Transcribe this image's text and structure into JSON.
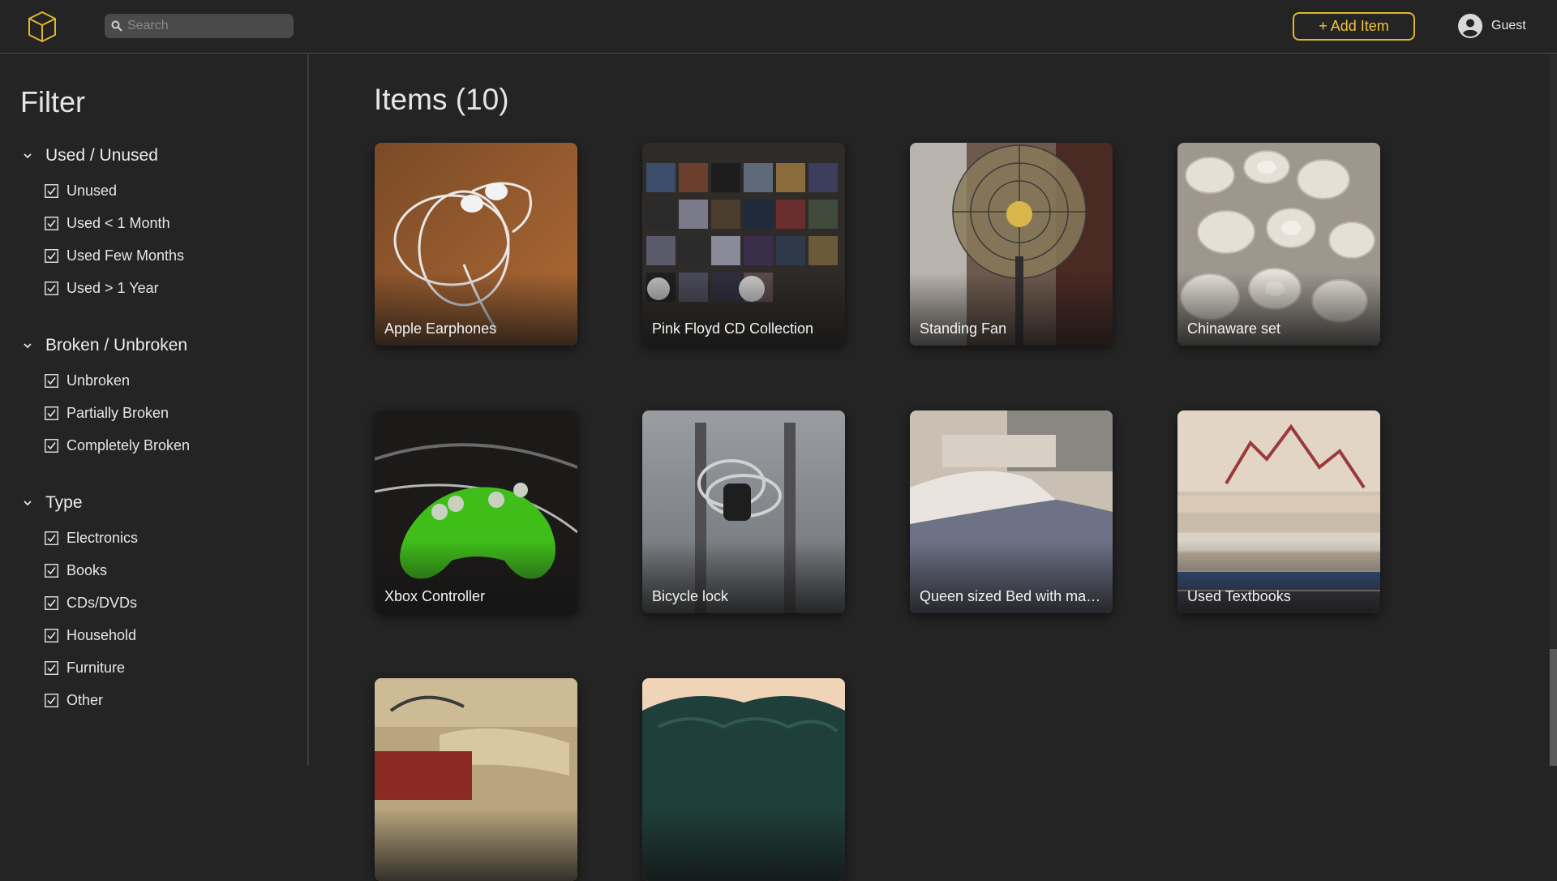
{
  "header": {
    "logo_icon": "cube-icon",
    "search_placeholder": "Search",
    "add_item_label": "+ Add Item",
    "user_label": "Guest",
    "accent": "#e0b62c"
  },
  "sidebar": {
    "title": "Filter",
    "groups": [
      {
        "label": "Used / Unused",
        "options": [
          "Unused",
          "Used < 1 Month",
          "Used Few Months",
          "Used > 1 Year"
        ]
      },
      {
        "label": "Broken / Unbroken",
        "options": [
          "Unbroken",
          "Partially Broken",
          "Completely Broken"
        ]
      },
      {
        "label": "Type",
        "options": [
          "Electronics",
          "Books",
          "CDs/DVDs",
          "Household",
          "Furniture",
          "Other"
        ]
      }
    ]
  },
  "main": {
    "title": "Items (10)",
    "items": [
      {
        "label": "Apple Earphones"
      },
      {
        "label": "Pink Floyd CD Collection"
      },
      {
        "label": "Standing Fan"
      },
      {
        "label": "Chinaware set"
      },
      {
        "label": "Xbox Controller"
      },
      {
        "label": "Bicycle lock"
      },
      {
        "label": "Queen sized Bed with matt..."
      },
      {
        "label": "Used Textbooks"
      },
      {
        "label": ""
      },
      {
        "label": ""
      }
    ]
  }
}
